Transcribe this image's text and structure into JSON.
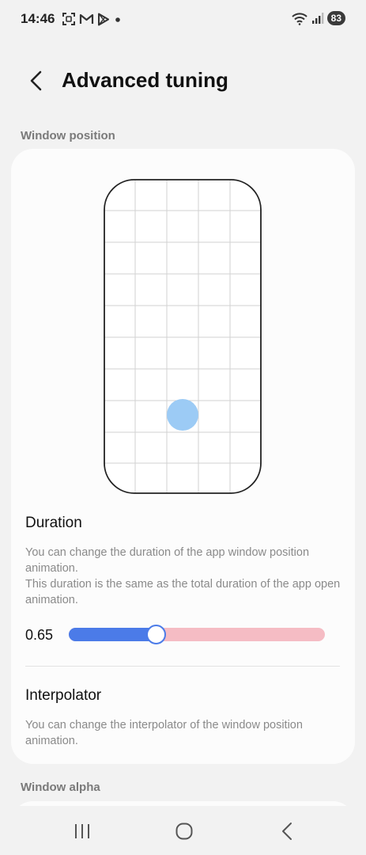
{
  "status_bar": {
    "time": "14:46",
    "battery": "83",
    "left_icons": [
      "screenshot-icon",
      "gmail-icon",
      "play-store-icon",
      "dot-icon"
    ],
    "right_icons": [
      "wifi-icon",
      "signal-icon"
    ]
  },
  "header": {
    "title": "Advanced tuning"
  },
  "sections": {
    "window_position": "Window position",
    "window_alpha": "Window alpha"
  },
  "duration": {
    "title": "Duration",
    "desc_line1": "You can change the duration of the app window position animation.",
    "desc_line2": "This duration is the same as the total duration of the app open animation.",
    "value": "0.65",
    "fraction": 0.34
  },
  "interpolator": {
    "title": "Interpolator",
    "desc": "You can change the interpolator of the window position animation."
  },
  "colors": {
    "accent": "#4b7be8",
    "track": "#f5bcc4",
    "position_dot": "#9ccbf5"
  }
}
